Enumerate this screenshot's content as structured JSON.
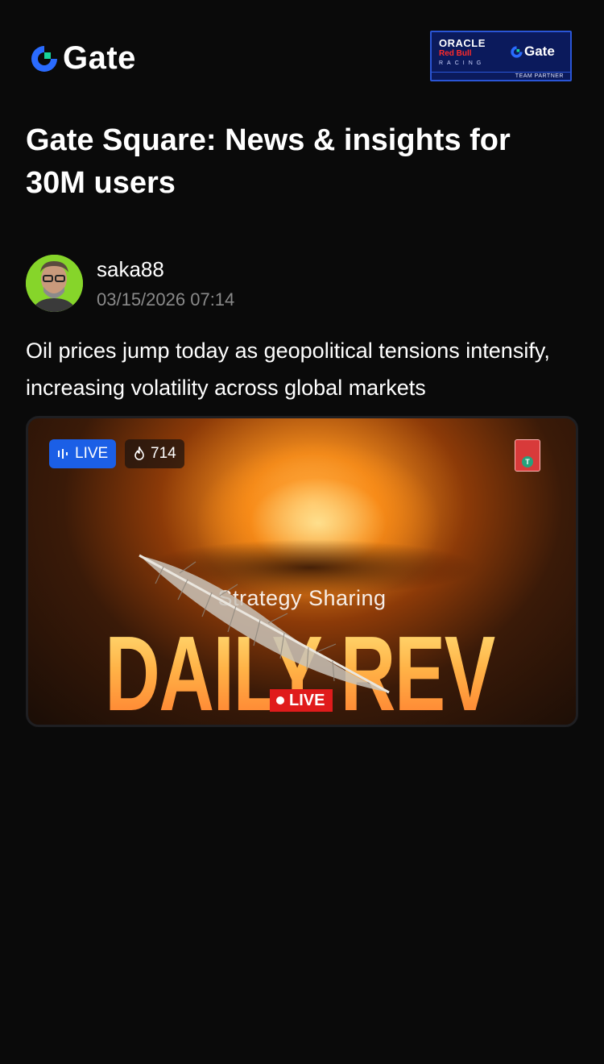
{
  "header": {
    "brand": "Gate",
    "partner": {
      "oracle": "ORACLE",
      "redbull": "Red Bull",
      "racing": "RACING",
      "brand": "Gate",
      "team": "TEAM PARTNER"
    }
  },
  "headline": "Gate Square: News & insights for 30M users",
  "post": {
    "author": "saka88",
    "timestamp": "03/15/2026 07:14",
    "text": "Oil prices jump today as geopolitical tensions intensify, increasing volatility across global markets",
    "live_badge": "LIVE",
    "view_count": "714",
    "thumb_subtitle": "Strategy Sharing",
    "thumb_title": "DAILY REVIEW",
    "thumb_live": "LIVE"
  },
  "colors": {
    "background": "#0a0a0a",
    "accent_blue": "#1b5fe6",
    "live_red": "#e01b1b",
    "muted_text": "#8a8a8a"
  }
}
